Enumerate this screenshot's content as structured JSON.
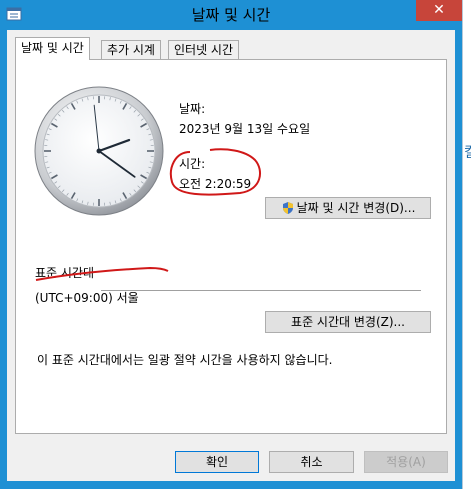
{
  "window": {
    "title": "날짜 및 시간",
    "close_glyph": "✕"
  },
  "tabs": [
    {
      "label": "날짜 및 시간",
      "active": true
    },
    {
      "label": "추가 시계",
      "active": false
    },
    {
      "label": "인터넷 시간",
      "active": false
    }
  ],
  "date_section": {
    "date_label": "날짜:",
    "date_value": "2023년 9월 13일 수요일",
    "time_label": "시간:",
    "time_value": "오전 2:20:59",
    "change_button": "날짜 및 시간 변경(D)..."
  },
  "timezone_section": {
    "heading": "표준 시간대",
    "value": "(UTC+09:00) 서울",
    "change_button": "표준 시간대 변경(Z)...",
    "dst_note": "이 표준 시간대에서는 일광 절약 시간을 사용하지 않습니다."
  },
  "footer": {
    "ok": "확인",
    "cancel": "취소",
    "apply": "적용(A)"
  },
  "clock": {
    "hour": 2,
    "minute": 20,
    "second": 59
  },
  "colors": {
    "titlebar": "#1e90d4",
    "close_button": "#c7453a",
    "annotation": "#d01818"
  },
  "right_strip": {
    "fragment_1": "킬",
    "fragment_2": "",
    "fragment_3": ""
  }
}
